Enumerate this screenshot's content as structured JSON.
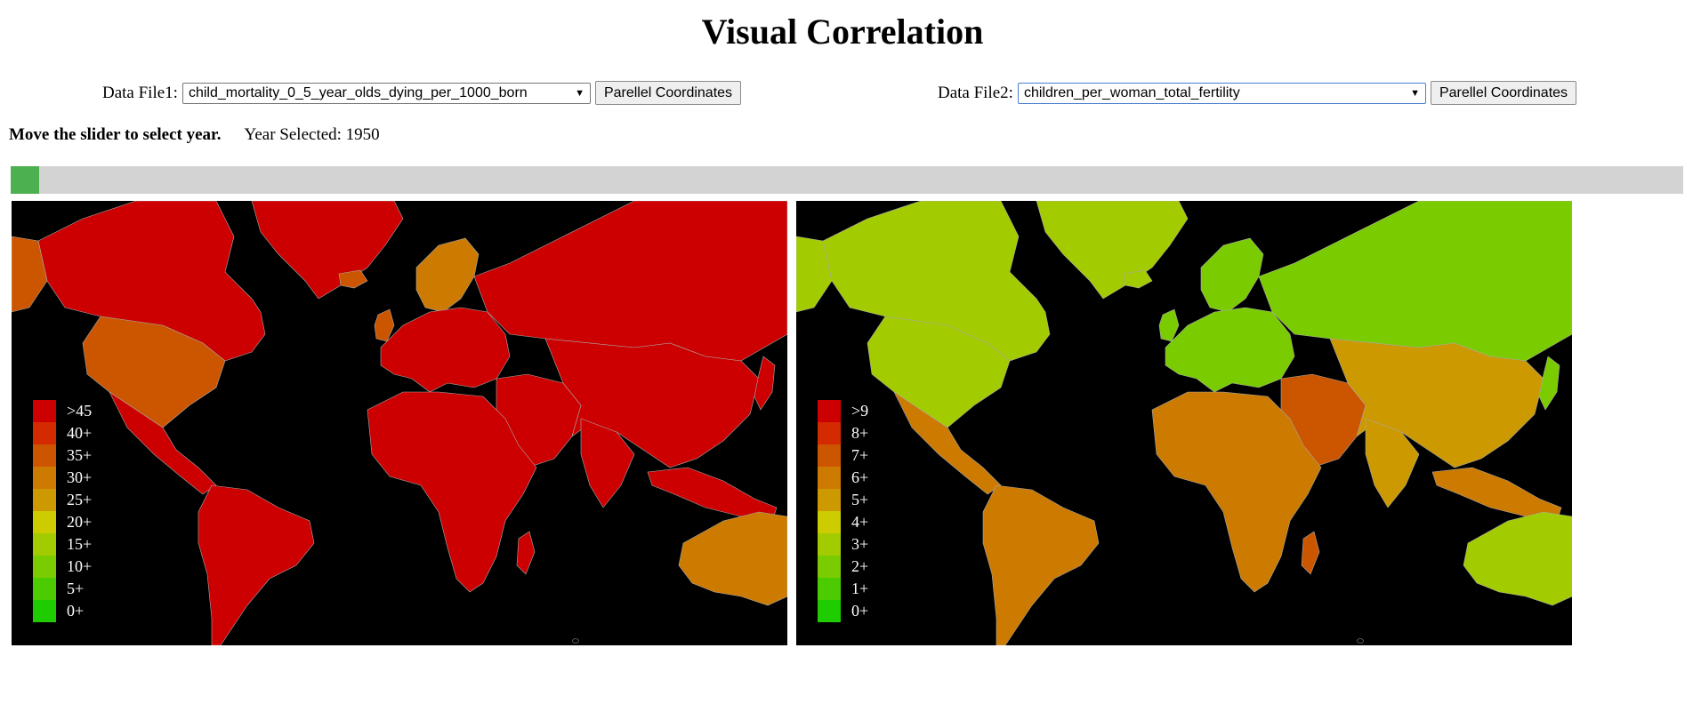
{
  "page": {
    "title": "Visual Correlation"
  },
  "controls": {
    "file1": {
      "label": "Data File1:",
      "value": "child_mortality_0_5_year_olds_dying_per_1000_born",
      "button": "Parellel Coordinates"
    },
    "file2": {
      "label": "Data File2:",
      "value": "children_per_woman_total_fertility",
      "button": "Parellel Coordinates"
    }
  },
  "slider": {
    "instruction": "Move the slider to select year.",
    "year_text": "Year Selected: 1950",
    "value_fraction": 0.0
  },
  "maps": [
    {
      "name": "child_mortality",
      "legend": [
        {
          "label": ">45",
          "color": "#cc0000"
        },
        {
          "label": "40+",
          "color": "#d42a00"
        },
        {
          "label": "35+",
          "color": "#cc5500"
        },
        {
          "label": "30+",
          "color": "#cc7a00"
        },
        {
          "label": "25+",
          "color": "#cc9900"
        },
        {
          "label": "20+",
          "color": "#cccc00"
        },
        {
          "label": "15+",
          "color": "#a3cc00"
        },
        {
          "label": "10+",
          "color": "#7acc00"
        },
        {
          "label": "5+",
          "color": "#4ccc00"
        },
        {
          "label": "0+",
          "color": "#1fcc00"
        }
      ],
      "region_colors": {
        "north_america": "#cc0000",
        "usa": "#cc5500",
        "mexico_central": "#cc0000",
        "south_america": "#cc0000",
        "greenland": "#cc0000",
        "alaska": "#cc5500",
        "europe": "#cc0000",
        "scandinavia": "#cc7a00",
        "russia": "#cc0000",
        "asia": "#cc0000",
        "middle_east": "#cc0000",
        "africa": "#cc0000",
        "madagascar": "#cc0000",
        "india": "#cc0000",
        "indonesia": "#cc0000",
        "australia": "#cc7a00",
        "iceland": "#cc5500",
        "japan": "#cc0000",
        "uk": "#cc5500"
      }
    },
    {
      "name": "fertility",
      "legend": [
        {
          "label": ">9",
          "color": "#cc0000"
        },
        {
          "label": "8+",
          "color": "#d42a00"
        },
        {
          "label": "7+",
          "color": "#cc5500"
        },
        {
          "label": "6+",
          "color": "#cc7a00"
        },
        {
          "label": "5+",
          "color": "#cc9900"
        },
        {
          "label": "4+",
          "color": "#cccc00"
        },
        {
          "label": "3+",
          "color": "#a3cc00"
        },
        {
          "label": "2+",
          "color": "#7acc00"
        },
        {
          "label": "1+",
          "color": "#4ccc00"
        },
        {
          "label": "0+",
          "color": "#1fcc00"
        }
      ],
      "region_colors": {
        "north_america": "#a3cc00",
        "usa": "#a3cc00",
        "mexico_central": "#cc7a00",
        "south_america": "#cc7a00",
        "greenland": "#a3cc00",
        "alaska": "#a3cc00",
        "europe": "#7acc00",
        "scandinavia": "#7acc00",
        "russia": "#7acc00",
        "asia": "#cc9900",
        "middle_east": "#cc5500",
        "africa": "#cc7a00",
        "madagascar": "#cc5500",
        "india": "#cc9900",
        "indonesia": "#cc7a00",
        "australia": "#a3cc00",
        "iceland": "#a3cc00",
        "japan": "#7acc00",
        "uk": "#7acc00"
      }
    }
  ]
}
